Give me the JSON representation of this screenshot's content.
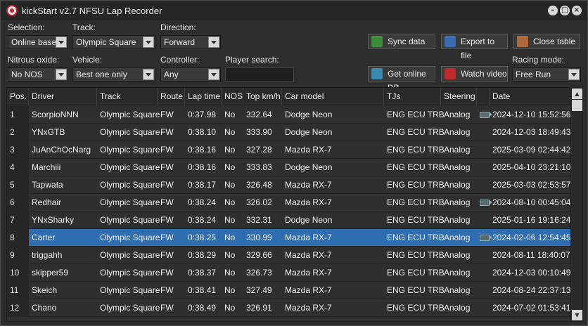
{
  "window": {
    "title": "kickStart v2.7 NFSU Lap Recorder",
    "minimize": "–",
    "maximize": "□",
    "close": "×"
  },
  "filters": {
    "selection": {
      "label": "Selection:",
      "value": "Online base"
    },
    "track": {
      "label": "Track:",
      "value": "Olympic Square"
    },
    "direction": {
      "label": "Direction:",
      "value": "Forward"
    },
    "nitrous": {
      "label": "Nitrous oxide:",
      "value": "No NOS"
    },
    "vehicle": {
      "label": "Vehicle:",
      "value": "Best one only"
    },
    "controller": {
      "label": "Controller:",
      "value": "Any"
    },
    "player_search": {
      "label": "Player search:",
      "value": ""
    },
    "racing_mode": {
      "label": "Racing mode:",
      "value": "Free Run"
    }
  },
  "buttons": {
    "sync": {
      "label": "Sync data",
      "icon": "sync-icon",
      "color": "#3c8c3c"
    },
    "export": {
      "label": "Export to file",
      "icon": "export-icon",
      "color": "#3a6db0"
    },
    "close_table": {
      "label": "Close table",
      "icon": "close-table-icon",
      "color": "#b06a3a"
    },
    "online_db": {
      "label": "Get online DB",
      "icon": "database-icon",
      "color": "#3a8ab0"
    },
    "watch_video": {
      "label": "Watch video",
      "icon": "video-icon",
      "color": "#c02a2a"
    }
  },
  "table": {
    "columns": [
      "Pos.",
      "Driver",
      "Track",
      "Route",
      "Lap time",
      "NOS",
      "Top km/h",
      "Car model",
      "TJs",
      "Steering",
      "",
      "Date"
    ],
    "selected_row": 7,
    "rows": [
      {
        "pos": "1",
        "driver": "ScorpioNNN",
        "track": "Olympic Square",
        "route": "FW",
        "lap": "0:37.98",
        "nos": "No",
        "top": "332.64",
        "car": "Dodge Neon",
        "tjs": "ENG ECU TRB",
        "steering": "Analog",
        "video": true,
        "date": "2024-12-10 15:52:56"
      },
      {
        "pos": "2",
        "driver": "YNxGTB",
        "track": "Olympic Square",
        "route": "FW",
        "lap": "0:38.10",
        "nos": "No",
        "top": "333.90",
        "car": "Dodge Neon",
        "tjs": "ENG ECU TRB",
        "steering": "Analog",
        "video": false,
        "date": "2024-12-03 18:49:43"
      },
      {
        "pos": "3",
        "driver": "JuAnChOcNarg",
        "track": "Olympic Square",
        "route": "FW",
        "lap": "0:38.16",
        "nos": "No",
        "top": "327.28",
        "car": "Mazda RX-7",
        "tjs": "ENG ECU TRB",
        "steering": "Analog",
        "video": false,
        "date": "2025-03-09 02:44:42"
      },
      {
        "pos": "4",
        "driver": "Marchiii",
        "track": "Olympic Square",
        "route": "FW",
        "lap": "0:38.16",
        "nos": "No",
        "top": "333.83",
        "car": "Dodge Neon",
        "tjs": "ENG ECU TRB",
        "steering": "Analog",
        "video": false,
        "date": "2025-04-10 23:21:10"
      },
      {
        "pos": "5",
        "driver": "Tapwata",
        "track": "Olympic Square",
        "route": "FW",
        "lap": "0:38.17",
        "nos": "No",
        "top": "326.48",
        "car": "Mazda RX-7",
        "tjs": "ENG ECU TRB",
        "steering": "Analog",
        "video": false,
        "date": "2025-03-03 02:53:57"
      },
      {
        "pos": "6",
        "driver": "Redhair",
        "track": "Olympic Square",
        "route": "FW",
        "lap": "0:38.24",
        "nos": "No",
        "top": "326.02",
        "car": "Mazda RX-7",
        "tjs": "ENG ECU TRB",
        "steering": "Analog",
        "video": true,
        "date": "2024-08-10 00:45:04"
      },
      {
        "pos": "7",
        "driver": "YNxSharky",
        "track": "Olympic Square",
        "route": "FW",
        "lap": "0:38.24",
        "nos": "No",
        "top": "332.31",
        "car": "Dodge Neon",
        "tjs": "ENG ECU TRB",
        "steering": "Analog",
        "video": false,
        "date": "2025-01-16 19:16:24"
      },
      {
        "pos": "8",
        "driver": "Carter",
        "track": "Olympic Square",
        "route": "FW",
        "lap": "0:38.25",
        "nos": "No",
        "top": "330.99",
        "car": "Mazda RX-7",
        "tjs": "ENG ECU TRB",
        "steering": "Analog",
        "video": true,
        "date": "2024-02-06 12:54:45"
      },
      {
        "pos": "9",
        "driver": "triggahh",
        "track": "Olympic Square",
        "route": "FW",
        "lap": "0:38.29",
        "nos": "No",
        "top": "329.66",
        "car": "Mazda RX-7",
        "tjs": "ENG ECU TRB",
        "steering": "Analog",
        "video": false,
        "date": "2024-08-11 18:40:07"
      },
      {
        "pos": "10",
        "driver": "skipper59",
        "track": "Olympic Square",
        "route": "FW",
        "lap": "0:38.37",
        "nos": "No",
        "top": "326.73",
        "car": "Mazda RX-7",
        "tjs": "ENG ECU TRB",
        "steering": "Analog",
        "video": false,
        "date": "2024-12-03 00:10:49"
      },
      {
        "pos": "11",
        "driver": "Skeich",
        "track": "Olympic Square",
        "route": "FW",
        "lap": "0:38.41",
        "nos": "No",
        "top": "327.49",
        "car": "Mazda RX-7",
        "tjs": "ENG ECU TRB",
        "steering": "Analog",
        "video": false,
        "date": "2024-08-24 22:37:13"
      },
      {
        "pos": "12",
        "driver": "Chano",
        "track": "Olympic Square",
        "route": "FW",
        "lap": "0:38.49",
        "nos": "No",
        "top": "326.91",
        "car": "Mazda RX-7",
        "tjs": "ENG ECU TRB",
        "steering": "Analog",
        "video": false,
        "date": "2024-07-02 01:53:41"
      }
    ]
  },
  "colors": {
    "selection": "#2f6db1",
    "background": "#2d2d2d"
  }
}
